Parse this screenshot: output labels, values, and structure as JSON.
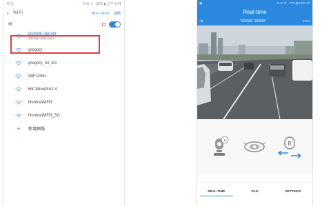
{
  "left_phone": {
    "status": {
      "left": "令回",
      "right": "N ✉ ᯤ ᐧ 32% ▮ 上午 9:41"
    },
    "header": {
      "title": "Wi-Fi",
      "wifi_direct": "Wi-Fi Direct",
      "more": "進階"
    },
    "toggle": {
      "label": "開"
    },
    "networks": [
      {
        "name": "i820WF 25040f",
        "subtitle": "網際網路可能無法使用",
        "selected": true
      },
      {
        "name": "gregory"
      },
      {
        "name": "gregory_mi_5G"
      },
      {
        "name": "WiFi-GML"
      },
      {
        "name": "HK-WinePro2.4"
      },
      {
        "name": "HonmaWiFi3"
      },
      {
        "name": "HonmaWiFi3_5G"
      }
    ],
    "add_network": "新增網路",
    "highlight_color": "#e23b3b"
  },
  "right_phone": {
    "status": {
      "left": "▣",
      "right": "N ✉ ᯤ ᐧ 27% ▮ 9:06 AM"
    },
    "header": {
      "title": "Real-time",
      "left_action": "Alt",
      "ssid": "\"i820WF 38090f\"",
      "right_action": "Front"
    },
    "tabs": [
      "REAL-TIME",
      "FILE",
      "SETTINGS"
    ],
    "active_tab": "REAL-TIME",
    "controls": [
      "record-button",
      "snapshot-button",
      "switch-camera-button"
    ],
    "switch_camera_letter": "B",
    "accent_color": "#2b88df"
  }
}
